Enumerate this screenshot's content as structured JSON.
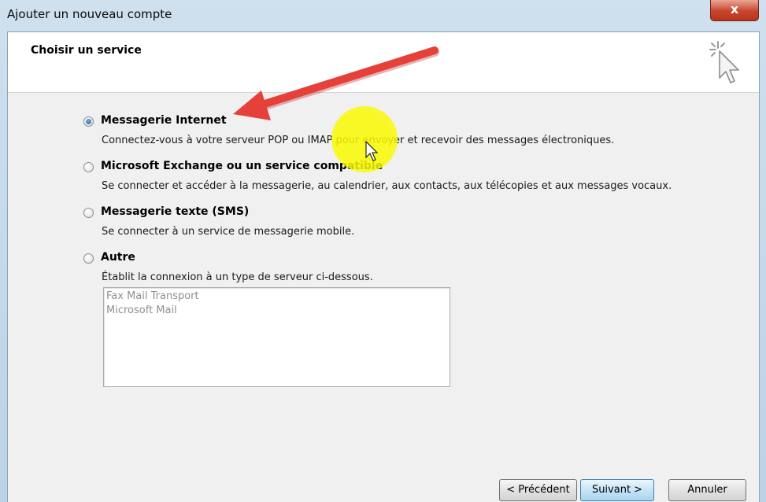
{
  "window": {
    "title": "Ajouter un nouveau compte",
    "close_label": "x"
  },
  "header": {
    "title": "Choisir un service"
  },
  "options": [
    {
      "label": "Messagerie Internet",
      "description": "Connectez-vous à votre serveur POP ou IMAP pour envoyer et recevoir des messages électroniques.",
      "checked": true
    },
    {
      "label": "Microsoft Exchange ou un service compatible",
      "description": "Se connecter et accéder à la messagerie, au calendrier, aux contacts, aux télécopies et aux messages vocaux.",
      "checked": false
    },
    {
      "label": "Messagerie texte (SMS)",
      "description": "Se connecter à un service de messagerie mobile.",
      "checked": false
    },
    {
      "label": "Autre",
      "description": "Établit la connexion à un type de serveur ci-dessous.",
      "checked": false
    }
  ],
  "other_list": {
    "items": [
      "Fax Mail Transport",
      "Microsoft Mail"
    ]
  },
  "buttons": {
    "back": "< Précédent",
    "next": "Suivant >",
    "cancel": "Annuler"
  },
  "colors": {
    "arrow": "#e5403a",
    "highlight": "#f5f500",
    "accent": "#1c5ea8"
  }
}
